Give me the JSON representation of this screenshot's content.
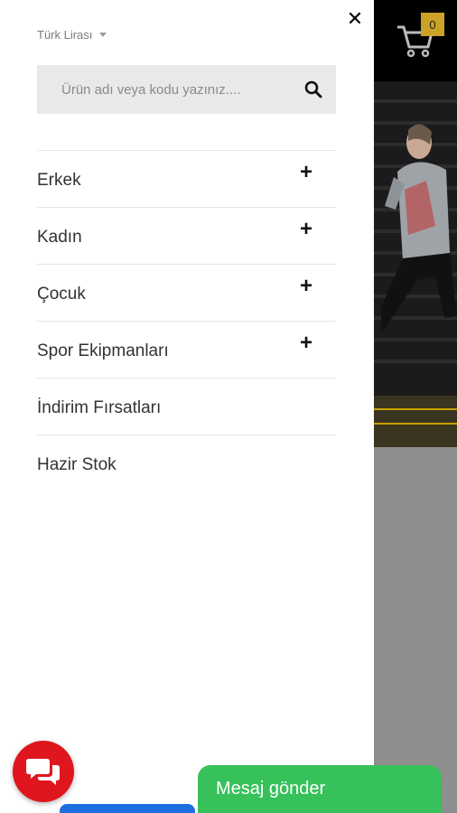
{
  "header": {
    "currency_label": "Türk Lirası",
    "cart_count": "0"
  },
  "search": {
    "placeholder": "Ürün adı veya kodu yazınız...."
  },
  "menu": {
    "items": [
      {
        "label": "Erkek",
        "expandable": true
      },
      {
        "label": "Kadın",
        "expandable": true
      },
      {
        "label": "Çocuk",
        "expandable": true
      },
      {
        "label": "Spor Ekipmanları",
        "expandable": true
      },
      {
        "label": "İndirim Fırsatları",
        "expandable": false
      },
      {
        "label": "Hazir Stok",
        "expandable": false
      }
    ],
    "expand_symbol": "+"
  },
  "close_symbol": "✕",
  "chat": {
    "message_button_label": "Mesaj gönder"
  },
  "colors": {
    "chat_bubble": "#e0161e",
    "message_button": "#36c15a",
    "cart_badge": "#c9a227",
    "blue_tab": "#1d6fe0"
  }
}
